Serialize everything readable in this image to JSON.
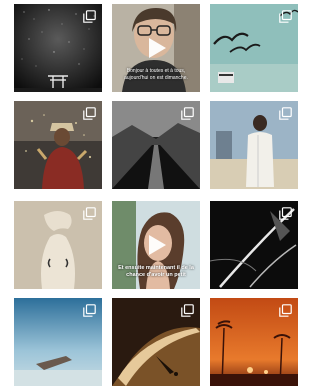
{
  "grid": {
    "tiles": [
      {
        "label": "night-sky-torii",
        "multi": true,
        "video": false
      },
      {
        "label": "woman-glasses-video",
        "multi": false,
        "video": true,
        "caption": "Bonjour à toutes et à tous, aujourd'hui on est dimanche."
      },
      {
        "label": "birds-in-sky",
        "multi": true,
        "video": false
      },
      {
        "label": "man-with-hat-sparks",
        "multi": true,
        "video": false
      },
      {
        "label": "mountain-valley-bw",
        "multi": true,
        "video": false
      },
      {
        "label": "man-in-white-coat",
        "multi": true,
        "video": false
      },
      {
        "label": "sculpture-violin-back",
        "multi": true,
        "video": false
      },
      {
        "label": "woman-profile-video",
        "multi": false,
        "video": true,
        "caption": "Et ensuite maintenant il de la chance d'avoir un petit"
      },
      {
        "label": "bw-abstract-lines",
        "multi": true,
        "video": false
      },
      {
        "label": "shipwreck-sea",
        "multi": true,
        "video": false
      },
      {
        "label": "desert-sand-closeup",
        "multi": true,
        "video": false
      },
      {
        "label": "orange-sky-palms",
        "multi": true,
        "video": false
      }
    ]
  },
  "colors": {
    "icon": "#ffffff",
    "background": "#ffffff"
  }
}
